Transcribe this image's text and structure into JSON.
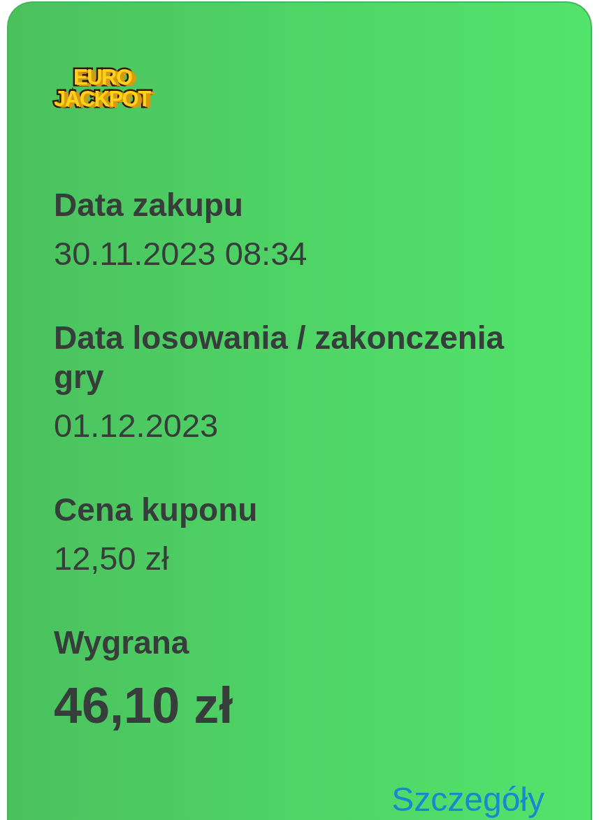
{
  "logo": {
    "line_1": "EURO",
    "line_2": "JACKPOT"
  },
  "fields": [
    {
      "kind": "normal",
      "label": "Data zakupu",
      "value": "30.11.2023 08:34"
    },
    {
      "kind": "normal",
      "label": "Data losowania / zakonczenia gry",
      "value": "01.12.2023"
    },
    {
      "kind": "normal",
      "label": "Cena kuponu",
      "value": "12,50 zł"
    },
    {
      "kind": "prize",
      "label": "Wygrana",
      "value": "46,10 zł"
    }
  ],
  "details_link": "Szczegóły"
}
